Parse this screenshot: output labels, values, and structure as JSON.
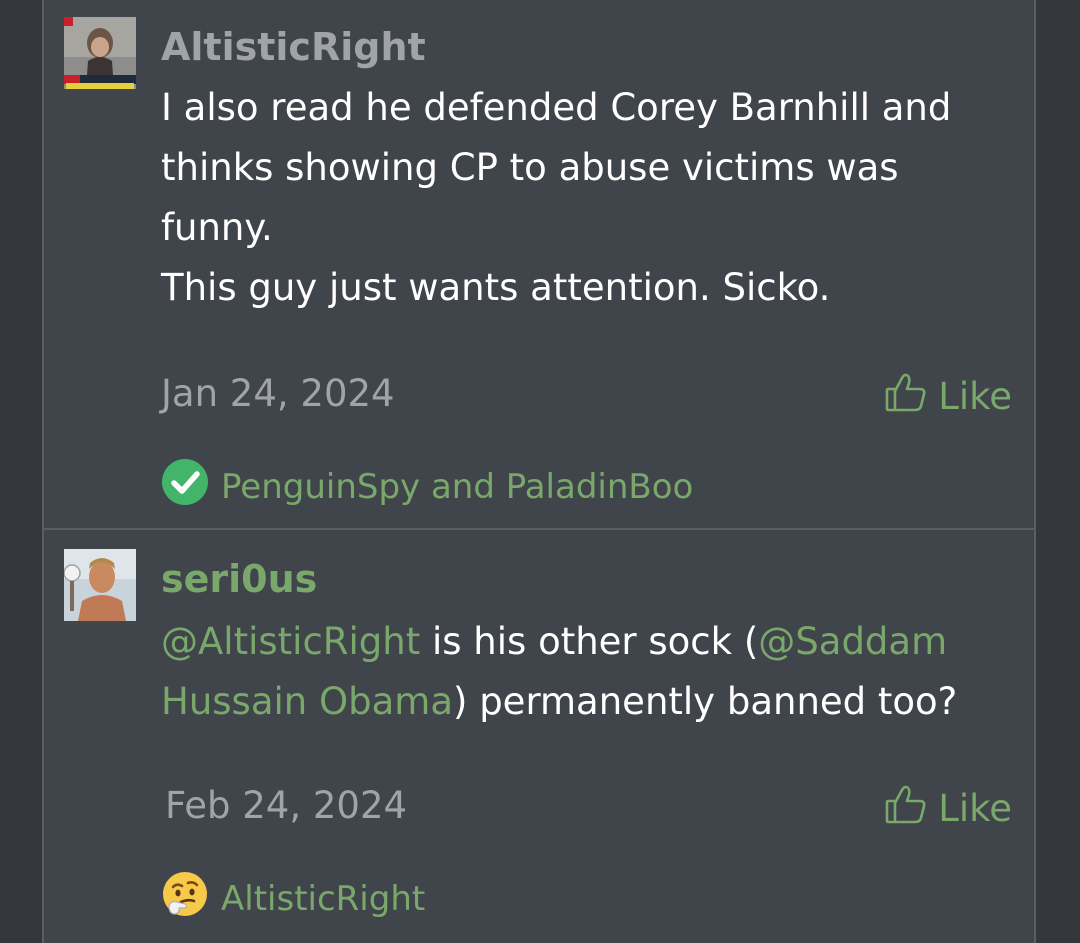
{
  "comments": [
    {
      "username": "AltisticRight",
      "body_lines": [
        "I also read he defended Corey Barnhill and",
        "thinks showing CP to abuse victims was",
        "funny.",
        "This guy just wants attention. Sicko."
      ],
      "date": "Jan 24, 2024",
      "like_label": "Like",
      "reactions_text": "PenguinSpy and PaladinBoo",
      "reaction_icon": "check-circle-icon"
    },
    {
      "username": "seri0us",
      "body": {
        "mention1": "@AltisticRight",
        "text1": " is his other sock (",
        "mention2a": "@Saddam",
        "mention2b": "Hussain Obama",
        "text2": ") permanently banned too?"
      },
      "date": "Feb 24, 2024",
      "like_label": "Like",
      "reactions_text": "AltisticRight",
      "reaction_icon": "thinking-face-icon"
    }
  ],
  "colors": {
    "page_background": "#34373c",
    "card_background": "#40444b",
    "accent_green": "#7aa86a",
    "muted_text": "#a0a4a8",
    "body_text": "#ffffff"
  }
}
